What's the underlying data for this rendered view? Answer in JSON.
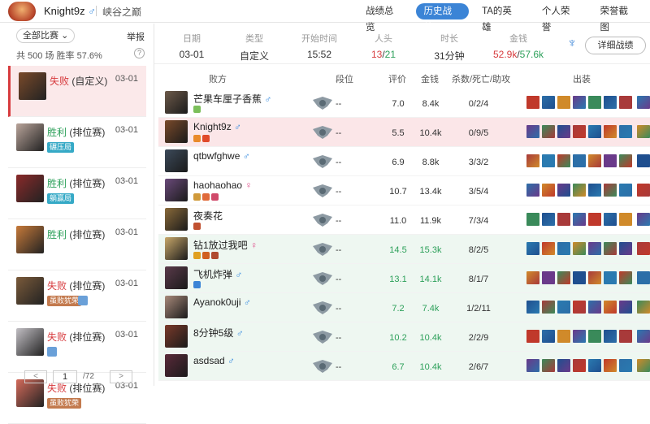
{
  "header": {
    "username": "Knight9z",
    "gender_symbol": "♂",
    "server": "峡谷之巅",
    "tabs": [
      {
        "label": "战绩总览",
        "active": false
      },
      {
        "label": "历史战绩",
        "active": true
      },
      {
        "label": "TA的英雄",
        "active": false
      },
      {
        "label": "个人荣誉",
        "active": false
      },
      {
        "label": "荣誉截图",
        "active": false
      }
    ]
  },
  "sidebar": {
    "filter": "全部比赛",
    "report": "举报",
    "stats": "共 500 场   胜率 57.6%",
    "help": "?",
    "matches": [
      {
        "result": "失败",
        "mode": "(自定义)",
        "date": "03-01",
        "win": false,
        "tag": "",
        "selected": true,
        "color": "#7a4a2a"
      },
      {
        "result": "胜利",
        "mode": "(排位赛)",
        "date": "03-01",
        "win": true,
        "tag": "碾压局",
        "selected": false,
        "color": "#b9a49a"
      },
      {
        "result": "胜利",
        "mode": "(排位赛)",
        "date": "03-01",
        "win": true,
        "tag": "躺赢局",
        "selected": false,
        "color": "#8a2a2a"
      },
      {
        "result": "胜利",
        "mode": "(排位赛)",
        "date": "03-01",
        "win": true,
        "tag": "",
        "selected": false,
        "color": "#c77a3a"
      },
      {
        "result": "失败",
        "mode": "(排位赛)",
        "date": "03-01",
        "win": false,
        "tag": "虽败犹荣",
        "selected": false,
        "color": "#7a5a3a"
      },
      {
        "result": "失败",
        "mode": "(排位赛)",
        "date": "03-01",
        "win": false,
        "tag": "",
        "selected": false,
        "color": "#c2bfc4"
      },
      {
        "result": "失败",
        "mode": "(排位赛)",
        "date": "03-01",
        "win": false,
        "tag": "虽败犹荣",
        "selected": false,
        "color": "#d46a5a"
      }
    ],
    "pager": {
      "prev": "<",
      "current": "1",
      "total": "/72",
      "next": ">"
    }
  },
  "summary": {
    "date_label": "日期",
    "date": "03-01",
    "type_label": "类型",
    "type": "自定义",
    "start_label": "开始时间",
    "start": "15:52",
    "kills_label": "人头",
    "kills_red": "13",
    "kills_sep": "/",
    "kills_green": "21",
    "duration_label": "时长",
    "duration": "31分钟",
    "gold_label": "金钱",
    "gold_red": "52.9k",
    "gold_sep": "/",
    "gold_green": "57.6k",
    "detail_button": "详细战绩"
  },
  "table": {
    "headers": {
      "team": "败方",
      "rank": "段位",
      "score": "评价",
      "gold": "金钱",
      "kda": "杀数/死亡/助攻",
      "items": "出装"
    },
    "rows": [
      {
        "name": "芒果车厘子香蕉",
        "gender": "♂",
        "rank": "--",
        "score": "7.0",
        "gold": "8.4k",
        "kda": "0/2/4",
        "me": false,
        "win": false,
        "avatar": "#6d5a4a"
      },
      {
        "name": "Knight9z",
        "gender": "♂",
        "rank": "--",
        "score": "5.5",
        "gold": "10.4k",
        "kda": "0/9/5",
        "me": true,
        "win": false,
        "avatar": "#7a4a2a"
      },
      {
        "name": "qtbwfghwe",
        "gender": "♂",
        "rank": "--",
        "score": "6.9",
        "gold": "8.8k",
        "kda": "3/3/2",
        "me": false,
        "win": false,
        "avatar": "#3c4a5a"
      },
      {
        "name": "haohaohao",
        "gender": "♀",
        "rank": "--",
        "score": "10.7",
        "gold": "13.4k",
        "kda": "3/5/4",
        "me": false,
        "win": false,
        "avatar": "#6a4a7a"
      },
      {
        "name": "夜奏花",
        "gender": "",
        "rank": "--",
        "score": "11.0",
        "gold": "11.9k",
        "kda": "7/3/4",
        "me": false,
        "win": false,
        "avatar": "#8a6a3a"
      },
      {
        "name": "钻1放过我吧",
        "gender": "♀",
        "rank": "--",
        "score": "14.5",
        "gold": "15.3k",
        "kda": "8/2/5",
        "me": false,
        "win": true,
        "avatar": "#c8a86a"
      },
      {
        "name": "飞机炸弹",
        "gender": "♂",
        "rank": "--",
        "score": "13.1",
        "gold": "14.1k",
        "kda": "8/1/7",
        "me": false,
        "win": true,
        "avatar": "#5a3a4a"
      },
      {
        "name": "Ayanok0uji",
        "gender": "♂",
        "rank": "--",
        "score": "7.2",
        "gold": "7.4k",
        "kda": "1/2/11",
        "me": false,
        "win": true,
        "avatar": "#a88a7a"
      },
      {
        "name": "8分钟5级",
        "gender": "♂",
        "rank": "--",
        "score": "10.2",
        "gold": "10.4k",
        "kda": "2/2/9",
        "me": false,
        "win": true,
        "avatar": "#7a3a2a"
      },
      {
        "name": "asdsad",
        "gender": "♂",
        "rank": "--",
        "score": "6.7",
        "gold": "10.4k",
        "kda": "2/6/7",
        "me": false,
        "win": true,
        "avatar": "#5a2a3a"
      }
    ]
  },
  "colors": {
    "accent": "#3b84d6",
    "win": "#2da05a",
    "loss": "#d73b3e"
  }
}
